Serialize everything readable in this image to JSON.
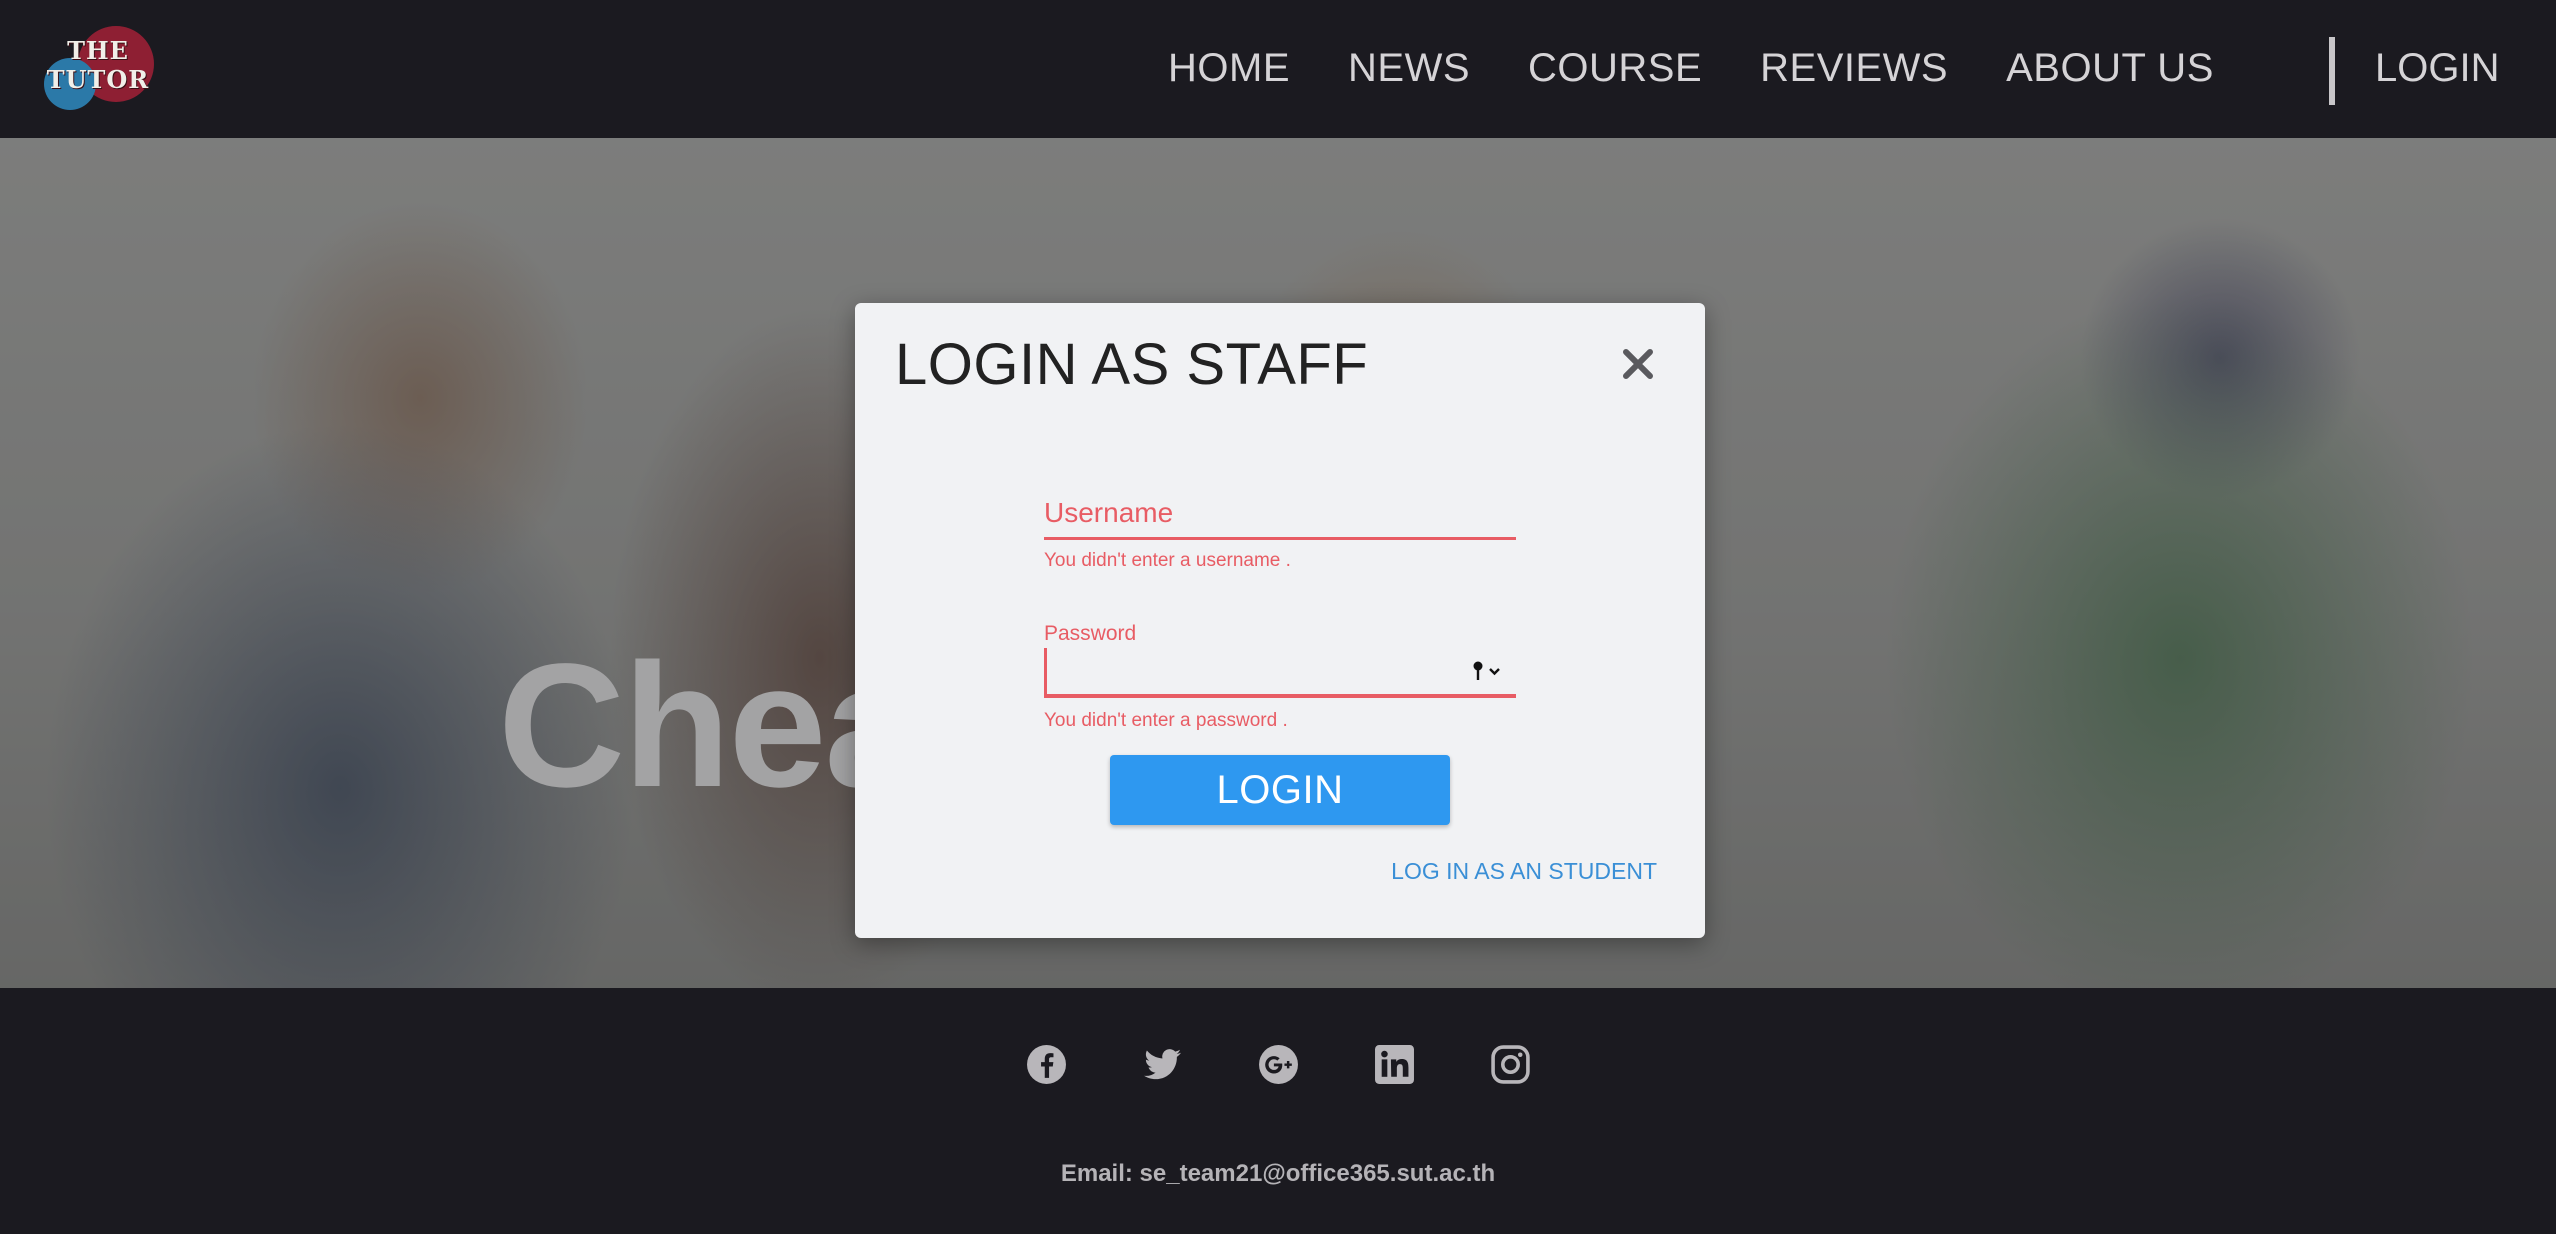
{
  "header": {
    "logo": {
      "line1": "THE",
      "line2": "TUTOR"
    },
    "nav": [
      "HOME",
      "NEWS",
      "COURSE",
      "REVIEWS",
      "ABOUT US"
    ],
    "login_label": "LOGIN"
  },
  "hero": {
    "heading": "Chea"
  },
  "modal": {
    "title": "LOGIN AS STAFF",
    "username": {
      "placeholder": "Username",
      "value": "",
      "error": "You didn't enter a username ."
    },
    "password": {
      "label": "Password",
      "value": "",
      "error": "You didn't enter a password ."
    },
    "login_button": "LOGIN",
    "student_link": "LOG IN AS AN STUDENT"
  },
  "footer": {
    "social_icons": [
      "facebook-icon",
      "twitter-icon",
      "google-plus-icon",
      "linkedin-icon",
      "instagram-icon"
    ],
    "email": "Email: se_team21@office365.sut.ac.th"
  },
  "colors": {
    "header_bg": "#1b1a20",
    "error_red": "#e85c64",
    "primary_blue": "#2e98f0",
    "link_blue": "#3a8fd6",
    "modal_bg": "#f1f2f4"
  }
}
